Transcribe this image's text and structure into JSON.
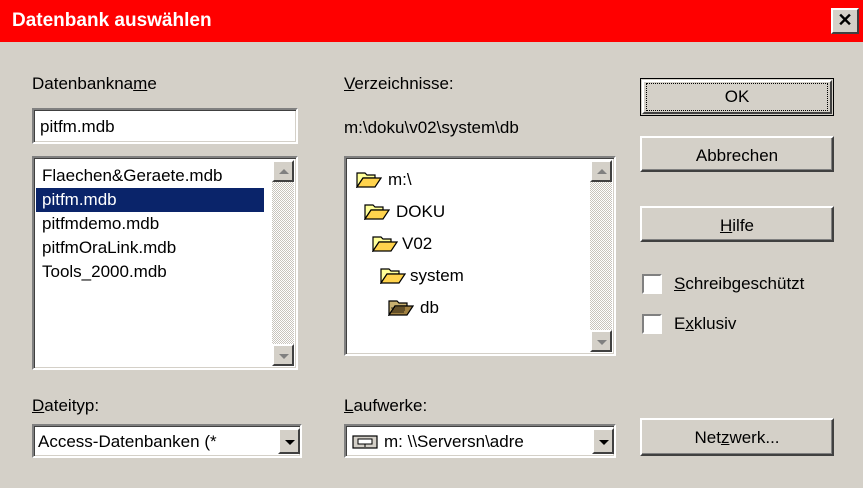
{
  "window": {
    "title": "Datenbank auswählen",
    "close": "✕"
  },
  "dbname": {
    "label_pre": "Datenbankna",
    "label_ul": "m",
    "label_post": "e",
    "value": "pitfm.mdb"
  },
  "files": [
    "Flaechen&Geraete.mdb",
    "pitfm.mdb",
    "pitfmdemo.mdb",
    "pitfmOraLink.mdb",
    "Tools_2000.mdb"
  ],
  "dirs": {
    "label_ul": "V",
    "label_post": "erzeichnisse:",
    "path": "m:\\doku\\v02\\system\\db",
    "items": [
      "m:\\",
      "DOKU",
      "V02",
      "system",
      "db"
    ]
  },
  "filetype": {
    "label_ul": "D",
    "label_post": "ateityp:",
    "value": "Access-Datenbanken (*"
  },
  "drives": {
    "label_ul": "L",
    "label_post": "aufwerke:",
    "value": "m: \\\\Serversn\\adre"
  },
  "buttons": {
    "ok": "OK",
    "cancel": "Abbrechen",
    "help_ul": "H",
    "help_post": "ilfe",
    "network_pre": "Net",
    "network_ul": "z",
    "network_post": "werk..."
  },
  "options": {
    "readonly_ul": "S",
    "readonly_post": "chreibgeschützt",
    "exclusive_pre": "E",
    "exclusive_ul": "x",
    "exclusive_post": "klusiv"
  }
}
